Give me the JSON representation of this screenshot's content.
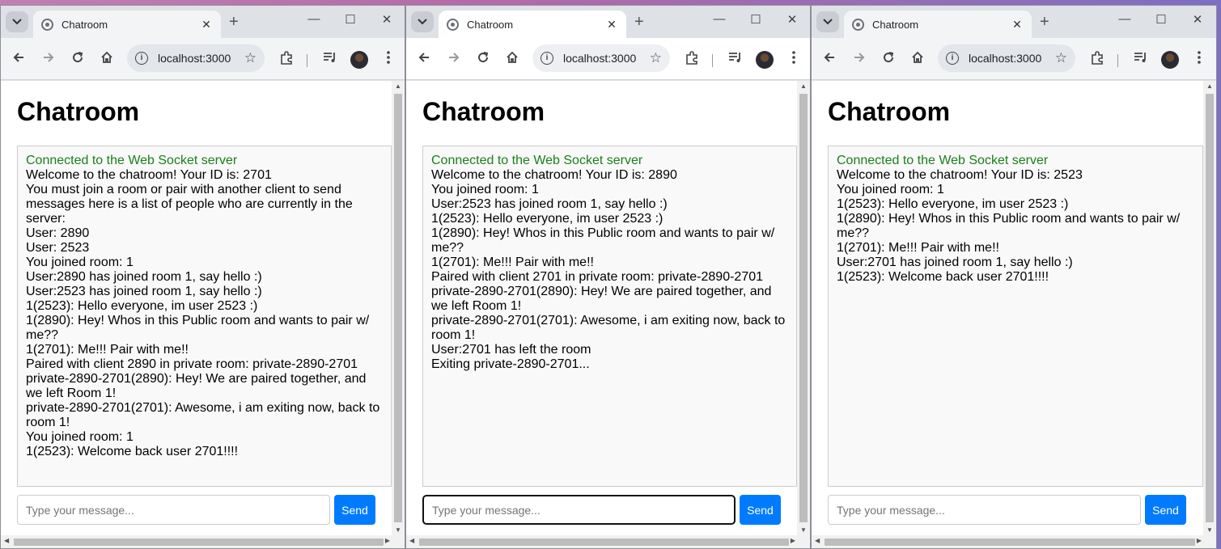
{
  "windows": [
    {
      "tab_title": "Chatroom",
      "url": "localhost:3000",
      "heading": "Chatroom",
      "messages": [
        {
          "text": "Connected to the Web Socket server",
          "color": "green"
        },
        {
          "text": "Welcome to the chatroom! Your ID is: 2701"
        },
        {
          "text": "You must join a room or pair with another client to send"
        },
        {
          "text": "messages here is a list of people who are currently in the"
        },
        {
          "text": "server:"
        },
        {
          "text": "User: 2890"
        },
        {
          "text": "User: 2523"
        },
        {
          "text": "You joined room: 1"
        },
        {
          "text": "User:2890 has joined room 1, say hello :)"
        },
        {
          "text": "User:2523 has joined room 1, say hello :)"
        },
        {
          "text": "1(2523): Hello everyone, im user 2523 :)"
        },
        {
          "text": "1(2890): Hey! Whos in this Public room and wants to pair w/"
        },
        {
          "text": "me??"
        },
        {
          "text": "1(2701): Me!!! Pair with me!!"
        },
        {
          "text": "Paired with client 2890 in private room: private-2890-2701"
        },
        {
          "text": "private-2890-2701(2890): Hey! We are paired together, and"
        },
        {
          "text": "we left Room 1!"
        },
        {
          "text": "private-2890-2701(2701): Awesome, i am exiting now, back to"
        },
        {
          "text": "room 1!"
        },
        {
          "text": "You joined room: 1"
        },
        {
          "text": "1(2523): Welcome back user 2701!!!!"
        }
      ],
      "input_placeholder": "Type your message...",
      "send_label": "Send",
      "focused": false
    },
    {
      "tab_title": "Chatroom",
      "url": "localhost:3000",
      "heading": "Chatroom",
      "messages": [
        {
          "text": "Connected to the Web Socket server",
          "color": "green"
        },
        {
          "text": "Welcome to the chatroom! Your ID is: 2890"
        },
        {
          "text": "You joined room: 1"
        },
        {
          "text": "User:2523 has joined room 1, say hello :)"
        },
        {
          "text": "1(2523): Hello everyone, im user 2523 :)"
        },
        {
          "text": "1(2890): Hey! Whos in this Public room and wants to pair w/"
        },
        {
          "text": "me??"
        },
        {
          "text": "1(2701): Me!!! Pair with me!!"
        },
        {
          "text": "Paired with client 2701 in private room: private-2890-2701"
        },
        {
          "text": "private-2890-2701(2890): Hey! We are paired together, and"
        },
        {
          "text": "we left Room 1!"
        },
        {
          "text": "private-2890-2701(2701): Awesome, i am exiting now, back to"
        },
        {
          "text": "room 1!"
        },
        {
          "text": "User:2701 has left the room"
        },
        {
          "text": "Exiting private-2890-2701..."
        }
      ],
      "input_placeholder": "Type your message...",
      "send_label": "Send",
      "focused": true
    },
    {
      "tab_title": "Chatroom",
      "url": "localhost:3000",
      "heading": "Chatroom",
      "messages": [
        {
          "text": "Connected to the Web Socket server",
          "color": "green"
        },
        {
          "text": "Welcome to the chatroom! Your ID is: 2523"
        },
        {
          "text": "You joined room: 1"
        },
        {
          "text": "1(2523): Hello everyone, im user 2523 :)"
        },
        {
          "text": "1(2890): Hey! Whos in this Public room and wants to pair w/"
        },
        {
          "text": "me??"
        },
        {
          "text": "1(2701): Me!!! Pair with me!!"
        },
        {
          "text": "User:2701 has joined room 1, say hello :)"
        },
        {
          "text": "1(2523): Welcome back user 2701!!!!"
        }
      ],
      "input_placeholder": "Type your message...",
      "send_label": "Send",
      "focused": false
    }
  ],
  "icons": {
    "tab_search": "chevron-down-icon",
    "favicon": "globe-icon",
    "back": "back-arrow-icon",
    "forward": "forward-arrow-icon",
    "reload": "reload-icon",
    "home": "home-icon",
    "info": "info-icon",
    "bookmark": "star-icon",
    "extensions": "puzzle-icon",
    "media": "media-queue-icon",
    "menu": "kebab-menu-icon"
  },
  "colors": {
    "connected_text": "#1a7f1a",
    "send_button": "#007bff"
  }
}
